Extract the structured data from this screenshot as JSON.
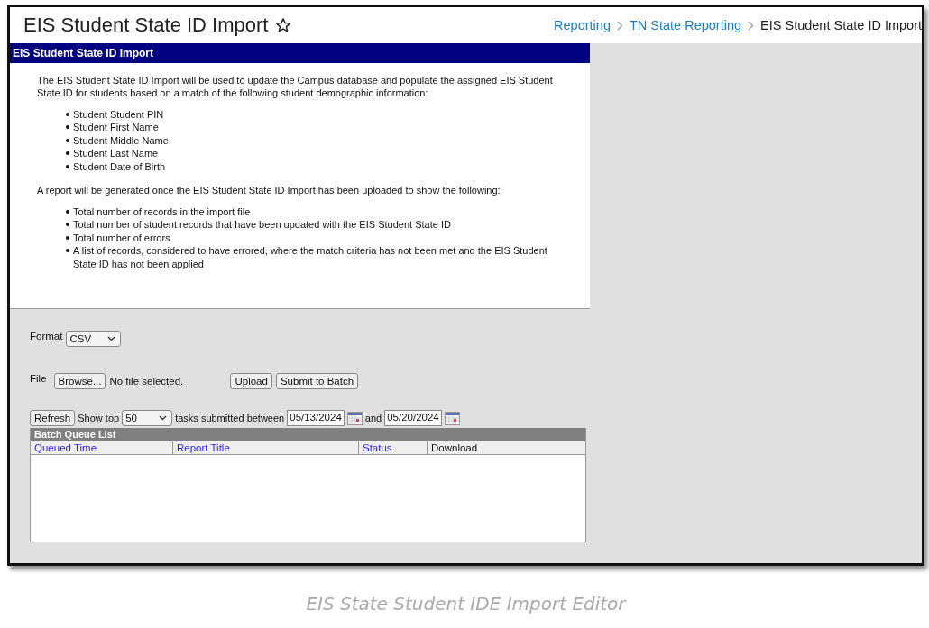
{
  "page_title": "EIS Student State ID Import",
  "breadcrumbs": [
    {
      "label": "Reporting",
      "current": false
    },
    {
      "label": "TN State Reporting",
      "current": false
    },
    {
      "label": "EIS Student State ID Import",
      "current": true
    }
  ],
  "panel": {
    "title": "EIS Student State ID Import",
    "intro": "The EIS Student State ID Import will be used to update the Campus database and populate the assigned EIS Student State ID for students based on a match of the following student demographic information:",
    "match_fields": [
      "Student Student PIN",
      "Student First Name",
      "Student Middle Name",
      "Student Last Name",
      "Student Date of Birth"
    ],
    "report_intro": "A report will be generated once the EIS Student State ID Import has been uploaded to show the following:",
    "report_items": [
      "Total number of records in the import file",
      "Total number of student records that have been updated with the EIS Student State ID",
      "Total number of errors",
      "A list of records, considered to have errored, where the match criteria has not been met and the EIS Student State ID has not been applied"
    ]
  },
  "form": {
    "format": {
      "label": "Format",
      "value": "CSV"
    },
    "file": {
      "label": "File",
      "browse": "Browse...",
      "status": "No file selected.",
      "buttons": [
        "Upload",
        "Submit to Batch"
      ]
    },
    "queue_filter": {
      "refresh": "Refresh",
      "show_top": "Show top",
      "count": "50",
      "between": "tasks submitted between",
      "start": "05/13/2024",
      "and": "and",
      "end": "05/20/2024"
    }
  },
  "batch_queue": {
    "title": "Batch Queue List",
    "columns": [
      {
        "label": "Queued Time",
        "sortable": true
      },
      {
        "label": "Report Title",
        "sortable": true
      },
      {
        "label": "Status",
        "sortable": true
      },
      {
        "label": "Download",
        "sortable": false
      }
    ]
  },
  "caption": "EIS State Student IDE Import Editor"
}
